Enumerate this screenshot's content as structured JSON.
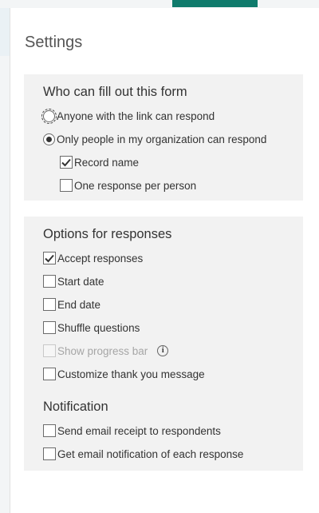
{
  "colors": {
    "accent": "#0f7b6c",
    "section_bg": "#f2f2f2",
    "disabled_text": "#a6a6a6"
  },
  "settings": {
    "title": "Settings",
    "who_can_fill": {
      "heading": "Who can fill out this form",
      "options": [
        {
          "label": "Anyone with the link can respond",
          "selected": false,
          "focused": true
        },
        {
          "label": "Only people in my organization can respond",
          "selected": true
        }
      ],
      "sub_options": [
        {
          "label": "Record name",
          "checked": true
        },
        {
          "label": "One response per person",
          "checked": false
        }
      ]
    },
    "options_for_responses": {
      "heading": "Options for responses",
      "items": [
        {
          "label": "Accept responses",
          "checked": true,
          "disabled": false
        },
        {
          "label": "Start date",
          "checked": false,
          "disabled": false
        },
        {
          "label": "End date",
          "checked": false,
          "disabled": false
        },
        {
          "label": "Shuffle questions",
          "checked": false,
          "disabled": false
        },
        {
          "label": "Show progress bar",
          "checked": false,
          "disabled": true,
          "info_icon": "info-icon"
        },
        {
          "label": "Customize thank you message",
          "checked": false,
          "disabled": false
        }
      ]
    },
    "notification": {
      "heading": "Notification",
      "items": [
        {
          "label": "Send email receipt to respondents",
          "checked": false
        },
        {
          "label": "Get email notification of each response",
          "checked": false
        }
      ]
    }
  }
}
